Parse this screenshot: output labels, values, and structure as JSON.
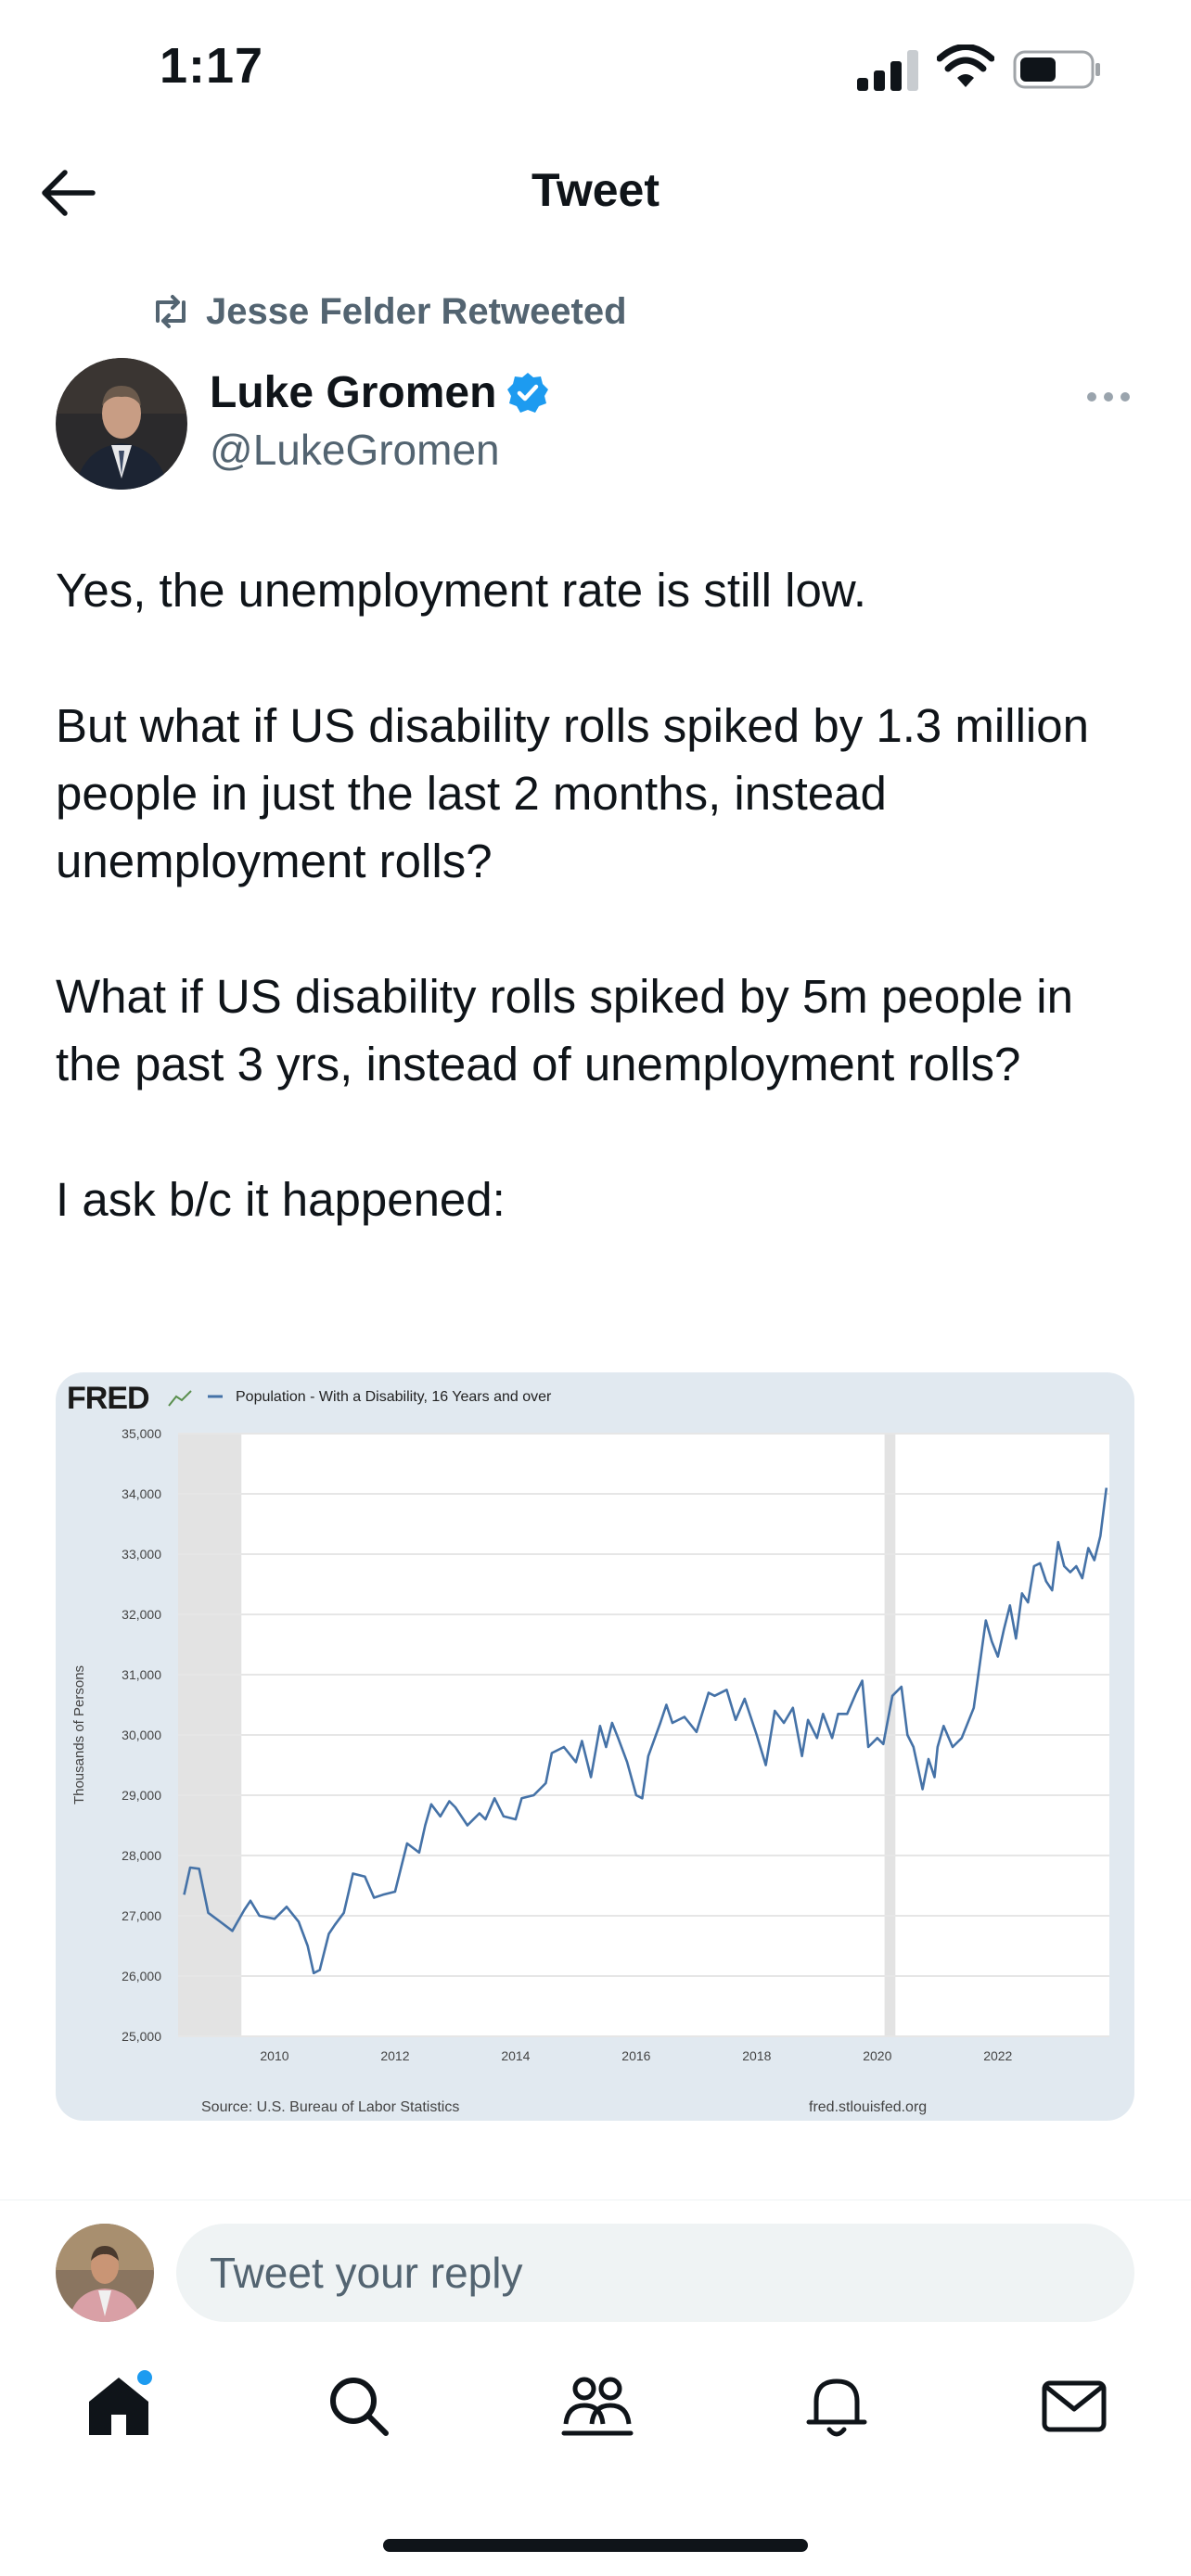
{
  "status_bar": {
    "time": "1:17"
  },
  "header": {
    "title": "Tweet"
  },
  "retweet": {
    "text": "Jesse Felder Retweeted"
  },
  "author": {
    "name": "Luke Gromen",
    "handle": "@LukeGromen"
  },
  "tweet": {
    "paragraphs": [
      "Yes, the unemployment rate is still low.",
      "But what if US disability rolls spiked by 1.3 million people in just the last 2 months, instead unemployment rolls?",
      "What if US disability rolls spiked by 5m people in the past 3 yrs, instead of unemployment rolls?",
      "I ask b/c it happened:"
    ]
  },
  "chart_data": {
    "type": "line",
    "brand": "FRED",
    "series": [
      {
        "name": "Population - With a Disability, 16 Years and over",
        "color": "#4572a7",
        "points": [
          [
            2008.5,
            27350
          ],
          [
            2008.6,
            27800
          ],
          [
            2008.75,
            27780
          ],
          [
            2008.9,
            27050
          ],
          [
            2009.1,
            26900
          ],
          [
            2009.3,
            26750
          ],
          [
            2009.5,
            27100
          ],
          [
            2009.6,
            27250
          ],
          [
            2009.75,
            27000
          ],
          [
            2010.0,
            26950
          ],
          [
            2010.2,
            27150
          ],
          [
            2010.4,
            26900
          ],
          [
            2010.55,
            26500
          ],
          [
            2010.65,
            26050
          ],
          [
            2010.75,
            26100
          ],
          [
            2010.9,
            26700
          ],
          [
            2011.0,
            26850
          ],
          [
            2011.15,
            27050
          ],
          [
            2011.3,
            27700
          ],
          [
            2011.5,
            27650
          ],
          [
            2011.65,
            27300
          ],
          [
            2011.8,
            27350
          ],
          [
            2012.0,
            27400
          ],
          [
            2012.2,
            28200
          ],
          [
            2012.4,
            28050
          ],
          [
            2012.5,
            28500
          ],
          [
            2012.6,
            28850
          ],
          [
            2012.75,
            28650
          ],
          [
            2012.9,
            28900
          ],
          [
            2013.0,
            28800
          ],
          [
            2013.2,
            28500
          ],
          [
            2013.4,
            28700
          ],
          [
            2013.5,
            28600
          ],
          [
            2013.65,
            28950
          ],
          [
            2013.8,
            28650
          ],
          [
            2014.0,
            28600
          ],
          [
            2014.1,
            28950
          ],
          [
            2014.3,
            29000
          ],
          [
            2014.5,
            29200
          ],
          [
            2014.6,
            29700
          ],
          [
            2014.8,
            29800
          ],
          [
            2015.0,
            29550
          ],
          [
            2015.1,
            29900
          ],
          [
            2015.25,
            29300
          ],
          [
            2015.4,
            30150
          ],
          [
            2015.5,
            29800
          ],
          [
            2015.6,
            30200
          ],
          [
            2015.7,
            29950
          ],
          [
            2015.85,
            29550
          ],
          [
            2016.0,
            29000
          ],
          [
            2016.1,
            28950
          ],
          [
            2016.2,
            29650
          ],
          [
            2016.4,
            30200
          ],
          [
            2016.5,
            30500
          ],
          [
            2016.6,
            30200
          ],
          [
            2016.8,
            30300
          ],
          [
            2017.0,
            30050
          ],
          [
            2017.2,
            30700
          ],
          [
            2017.3,
            30650
          ],
          [
            2017.5,
            30750
          ],
          [
            2017.65,
            30250
          ],
          [
            2017.8,
            30600
          ],
          [
            2018.0,
            30000
          ],
          [
            2018.15,
            29500
          ],
          [
            2018.3,
            30400
          ],
          [
            2018.45,
            30200
          ],
          [
            2018.6,
            30450
          ],
          [
            2018.75,
            29650
          ],
          [
            2018.85,
            30250
          ],
          [
            2019.0,
            29950
          ],
          [
            2019.1,
            30350
          ],
          [
            2019.25,
            29950
          ],
          [
            2019.35,
            30350
          ],
          [
            2019.5,
            30350
          ],
          [
            2019.65,
            30700
          ],
          [
            2019.75,
            30900
          ],
          [
            2019.85,
            29800
          ],
          [
            2020.0,
            29950
          ],
          [
            2020.1,
            29850
          ],
          [
            2020.25,
            30650
          ],
          [
            2020.4,
            30800
          ],
          [
            2020.5,
            30000
          ],
          [
            2020.6,
            29800
          ],
          [
            2020.75,
            29100
          ],
          [
            2020.85,
            29600
          ],
          [
            2020.95,
            29300
          ],
          [
            2021.0,
            29800
          ],
          [
            2021.1,
            30150
          ],
          [
            2021.25,
            29800
          ],
          [
            2021.4,
            29950
          ],
          [
            2021.6,
            30450
          ],
          [
            2021.8,
            31900
          ],
          [
            2021.9,
            31550
          ],
          [
            2022.0,
            31300
          ],
          [
            2022.1,
            31750
          ],
          [
            2022.2,
            32150
          ],
          [
            2022.3,
            31600
          ],
          [
            2022.4,
            32350
          ],
          [
            2022.5,
            32200
          ],
          [
            2022.6,
            32800
          ],
          [
            2022.7,
            32850
          ],
          [
            2022.8,
            32550
          ],
          [
            2022.9,
            32400
          ],
          [
            2023.0,
            33200
          ],
          [
            2023.1,
            32800
          ],
          [
            2023.2,
            32700
          ],
          [
            2023.3,
            32800
          ],
          [
            2023.4,
            32600
          ],
          [
            2023.5,
            33100
          ],
          [
            2023.6,
            32900
          ],
          [
            2023.7,
            33300
          ],
          [
            2023.8,
            34100
          ]
        ]
      }
    ],
    "xlim": [
      2008.4,
      2023.85
    ],
    "ylim": [
      25000,
      35000
    ],
    "y_ticks": [
      25000,
      26000,
      27000,
      28000,
      29000,
      30000,
      31000,
      32000,
      33000,
      34000,
      35000
    ],
    "y_tick_labels": [
      "25,000",
      "26,000",
      "27,000",
      "28,000",
      "29,000",
      "30,000",
      "31,000",
      "32,000",
      "33,000",
      "34,000",
      "35,000"
    ],
    "x_ticks": [
      2010,
      2012,
      2014,
      2016,
      2018,
      2020,
      2022
    ],
    "x_tick_labels": [
      "2010",
      "2012",
      "2014",
      "2016",
      "2018",
      "2020",
      "2022"
    ],
    "recessions": [
      [
        2008.4,
        2009.45
      ],
      [
        2020.12,
        2020.3
      ]
    ],
    "ylabel": "Thousands of Persons",
    "source": "Source: U.S. Bureau of Labor Statistics",
    "site": "fred.stlouisfed.org",
    "grid": true,
    "legend_position": "top-left"
  },
  "reply": {
    "placeholder": "Tweet your reply"
  },
  "tabs": [
    {
      "icon": "home-icon"
    },
    {
      "icon": "search-icon"
    },
    {
      "icon": "communities-icon"
    },
    {
      "icon": "notifications-icon"
    },
    {
      "icon": "messages-icon"
    }
  ],
  "colors": {
    "accent": "#1d9bf0",
    "secondary_text": "#536471",
    "chart_bg": "#e1e9f0"
  }
}
